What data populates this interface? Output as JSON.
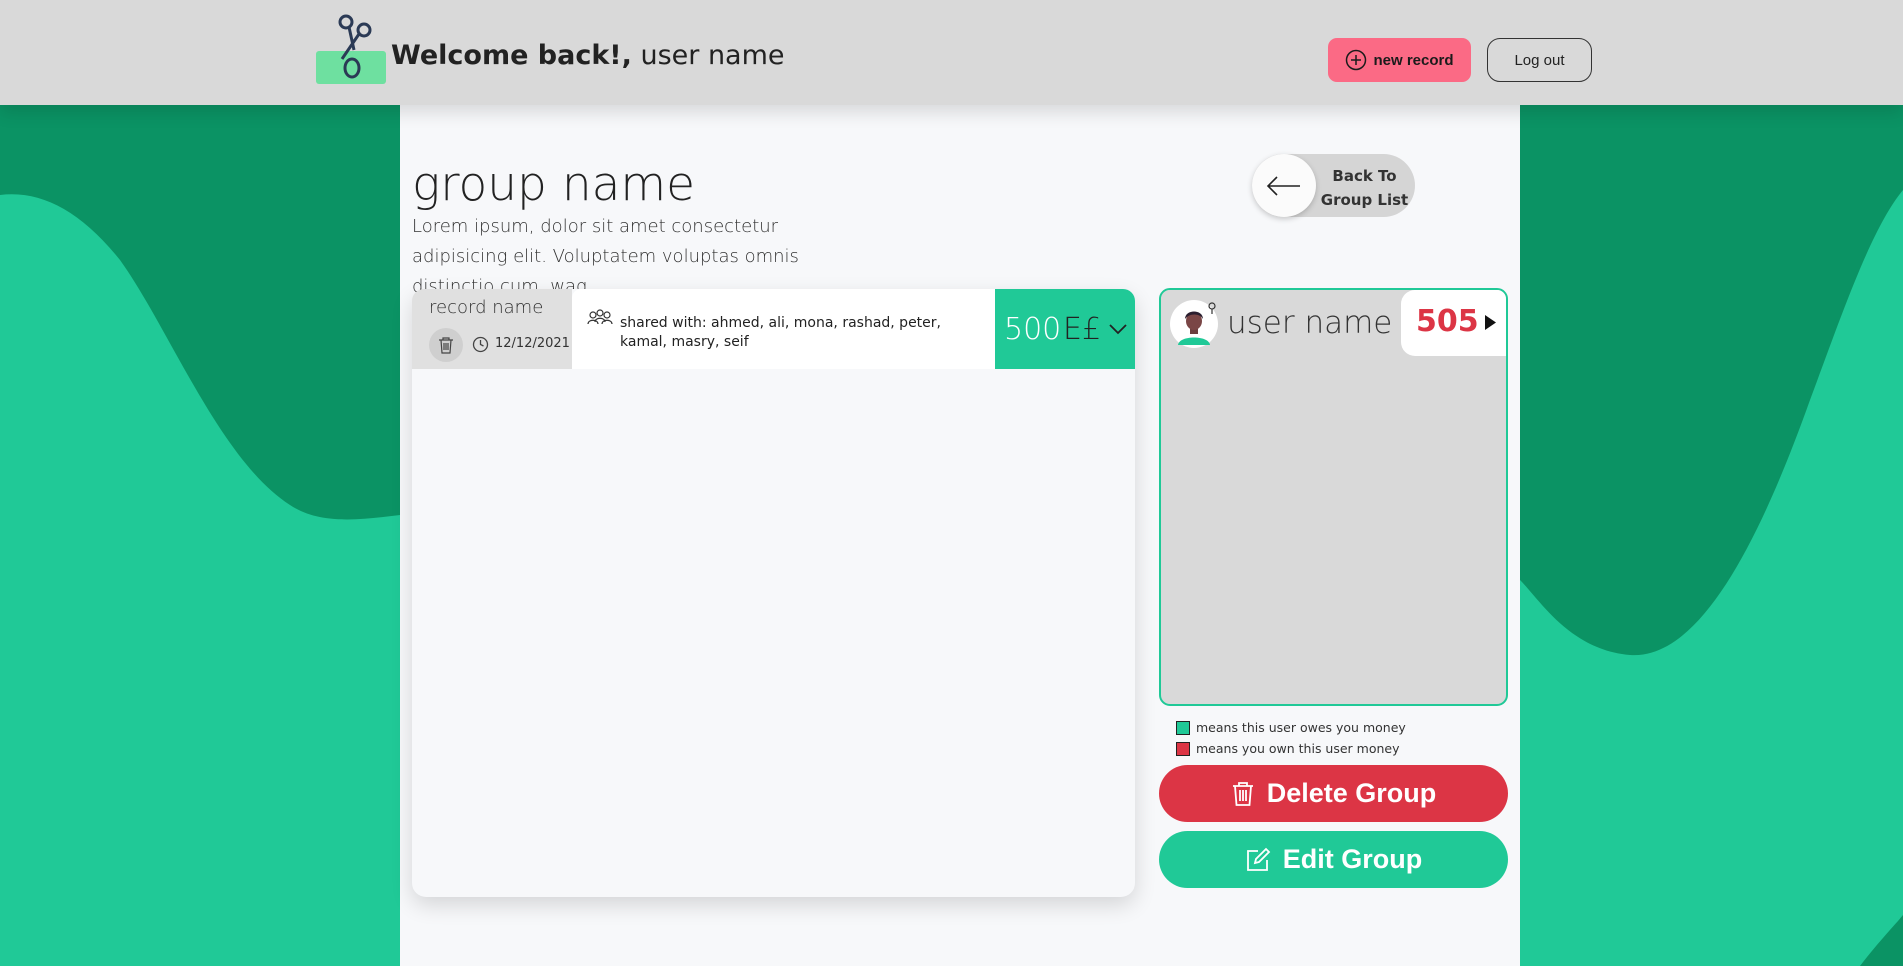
{
  "header": {
    "welcome": "Welcome back!,",
    "user_name": "user name",
    "new_record_label": "new record",
    "logout_label": "Log out"
  },
  "group": {
    "title": "group name",
    "description": "Lorem ipsum, dolor sit amet consectetur adipisicing elit. Voluptatem voluptas omnis distinctio cum, waq",
    "back_line1": "Back To",
    "back_line2": "Group List"
  },
  "records": [
    {
      "name": "record name",
      "date": "12/12/2021",
      "shared_with": "shared with:  ahmed, ali, mona, rashad, peter, kamal, masry, seif",
      "amount": "500",
      "currency": "E£"
    }
  ],
  "members": [
    {
      "name": "user name",
      "balance": "505"
    }
  ],
  "legend": {
    "owes_you": "means this user owes you money",
    "you_owe": "means you own this user money"
  },
  "actions": {
    "delete_label": "Delete Group",
    "edit_label": "Edit Group"
  },
  "colors": {
    "accent_green": "#20c997",
    "dark_green": "#0b9364",
    "danger_red": "#dc3545",
    "new_record_pink": "#fb6a85",
    "header_gray": "#d9d9d9"
  }
}
